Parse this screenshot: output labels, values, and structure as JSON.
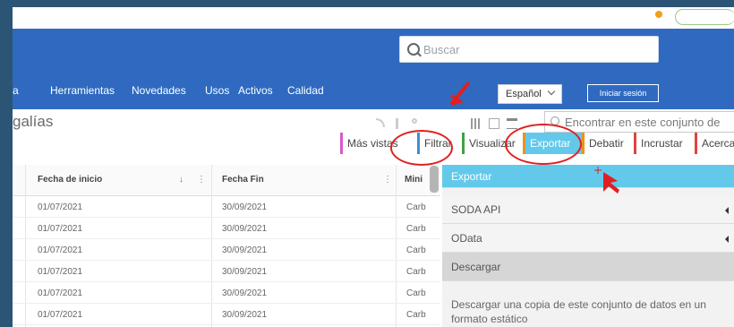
{
  "header": {
    "search_placeholder": "Buscar",
    "nav": [
      "a",
      "Herramientas",
      "Novedades",
      "Usos",
      "Activos",
      "Calidad"
    ],
    "language": "Español",
    "login": "Iniciar sesión"
  },
  "page": {
    "title": "galías",
    "find_placeholder": "Encontrar en este conjunto de"
  },
  "tabs": [
    "Más vistas",
    "Filtrar",
    "Visualizar",
    "Exportar",
    "Debatir",
    "Incrustar",
    "Acerca de"
  ],
  "table": {
    "headers": [
      "Fecha de inicio",
      "Fecha Fin",
      "Mini"
    ],
    "rows": [
      [
        "01/07/2021",
        "30/09/2021",
        "Carb"
      ],
      [
        "01/07/2021",
        "30/09/2021",
        "Carb"
      ],
      [
        "01/07/2021",
        "30/09/2021",
        "Carb"
      ],
      [
        "01/07/2021",
        "30/09/2021",
        "Carb"
      ],
      [
        "01/07/2021",
        "30/09/2021",
        "Carb"
      ],
      [
        "01/07/2021",
        "30/09/2021",
        "Carb"
      ]
    ]
  },
  "export_panel": {
    "title": "Exportar",
    "items": [
      "SODA API",
      "OData"
    ],
    "download": "Descargar",
    "description": "Descargar una copia de este conjunto de datos en un formato estático"
  },
  "colors": {
    "header_blue": "#2f6ac0",
    "export_cyan": "#63c9ea",
    "annotation_red": "#e02020"
  }
}
